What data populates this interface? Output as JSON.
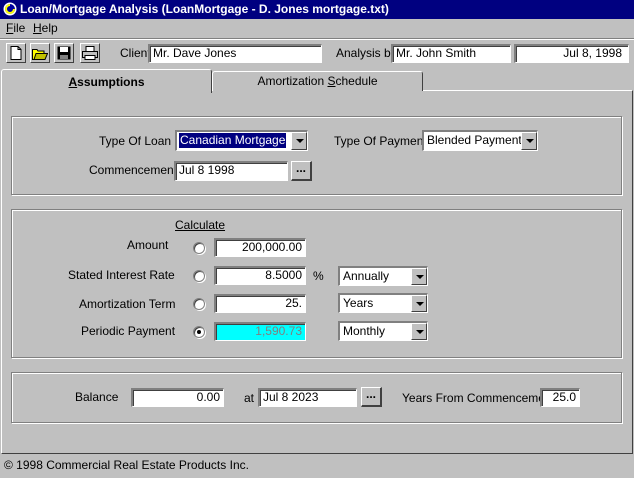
{
  "window": {
    "title": "Loan/Mortgage Analysis  (LoanMortgage - D. Jones mortgage.txt)"
  },
  "menu": [
    {
      "label": "File",
      "accel": "F",
      "rest": "ile"
    },
    {
      "label": "Help",
      "accel": "H",
      "rest": "elp"
    }
  ],
  "toolbar": {
    "buttons": [
      "new-document-icon",
      "open-folder-icon",
      "save-disk-icon",
      "print-icon"
    ],
    "client_label": "Client",
    "client_value": "Mr. Dave Jones",
    "analysis_label": "Analysis by",
    "analysis_value": "Mr. John Smith",
    "date_value": "Jul 8, 1998"
  },
  "tabs": [
    {
      "label": "Assumptions",
      "accel": "A",
      "rest": "ssumptions",
      "active": true
    },
    {
      "label": "Amortization Schedule",
      "pre": "Amortization ",
      "accel": "S",
      "rest": "chedule",
      "active": false
    }
  ],
  "loan": {
    "type_label": "Type Of Loan",
    "type_value": "Canadian Mortgage",
    "payment_type_label": "Type Of Payment",
    "payment_type_value": "Blended Payment",
    "commencement_label": "Commencement",
    "commencement_value": "Jul 8 1998",
    "ellipsis": "..."
  },
  "calc": {
    "header": "Calculate",
    "rows": [
      {
        "label": "Amount",
        "value": "200,000.00",
        "selected": false
      },
      {
        "label": "Stated Interest Rate",
        "value": "8.5000",
        "unit": "%",
        "option": "Annually",
        "selected": false
      },
      {
        "label": "Amortization Term",
        "value": "25.",
        "option": "Years",
        "selected": false
      },
      {
        "label": "Periodic Payment",
        "value": "1,590.73",
        "option": "Monthly",
        "selected": true
      }
    ]
  },
  "balance": {
    "label": "Balance",
    "value": "0.00",
    "at_label": "at",
    "date_value": "Jul 8 2023",
    "ellipsis": "...",
    "years_label": "Years From Commencement",
    "years_value": "25.0"
  },
  "status": {
    "copyright": "© 1998 Commercial Real Estate Products Inc."
  },
  "colors": {
    "titlebar": "#000080",
    "face": "#c0c0c0",
    "computed_field": "#00ffff"
  }
}
